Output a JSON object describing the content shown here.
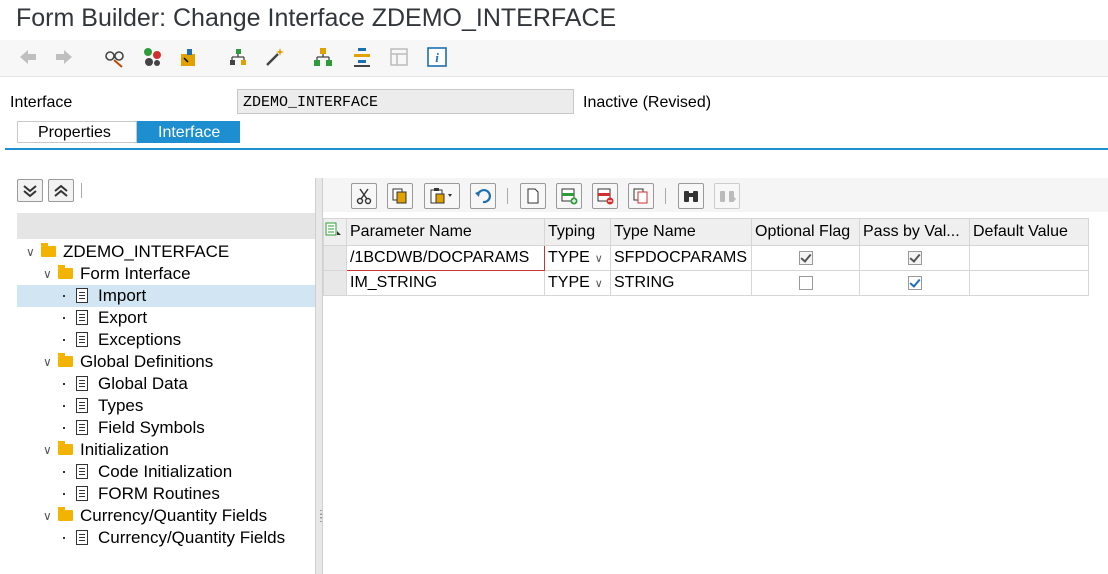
{
  "window": {
    "title": "Form Builder: Change Interface ZDEMO_INTERFACE"
  },
  "toolbar": {
    "icons": [
      "back-arrow-icon",
      "forward-arrow-icon",
      "glasses-display-change-icon",
      "activate-icon",
      "check-icon",
      "where-used-icon",
      "magic-wand-icon",
      "hierarchy-icon",
      "layout-icon",
      "layout-disabled-icon",
      "info-icon"
    ]
  },
  "header": {
    "interface_label": "Interface",
    "interface_value": "ZDEMO_INTERFACE",
    "status": "Inactive (Revised)"
  },
  "tabs": [
    {
      "label": "Properties",
      "active": false
    },
    {
      "label": "Interface",
      "active": true
    }
  ],
  "tree": {
    "nodes": [
      {
        "label": "ZDEMO_INTERFACE",
        "type": "folder",
        "level": 0,
        "expanded": true
      },
      {
        "label": "Form Interface",
        "type": "folder",
        "level": 1,
        "expanded": true
      },
      {
        "label": "Import",
        "type": "doc",
        "level": 2,
        "selected": true
      },
      {
        "label": "Export",
        "type": "doc",
        "level": 2
      },
      {
        "label": "Exceptions",
        "type": "doc",
        "level": 2
      },
      {
        "label": "Global Definitions",
        "type": "folder",
        "level": 1,
        "expanded": true
      },
      {
        "label": "Global Data",
        "type": "doc",
        "level": 2
      },
      {
        "label": "Types",
        "type": "doc",
        "level": 2
      },
      {
        "label": "Field Symbols",
        "type": "doc",
        "level": 2
      },
      {
        "label": "Initialization",
        "type": "folder",
        "level": 1,
        "expanded": true
      },
      {
        "label": "Code Initialization",
        "type": "doc",
        "level": 2
      },
      {
        "label": "FORM Routines",
        "type": "doc",
        "level": 2
      },
      {
        "label": "Currency/Quantity Fields",
        "type": "folder",
        "level": 1,
        "expanded": true
      },
      {
        "label": "Currency/Quantity Fields",
        "type": "doc",
        "level": 2
      }
    ]
  },
  "grid": {
    "columns": [
      "Parameter Name",
      "Typing",
      "Type Name",
      "Optional Flag",
      "Pass by Val...",
      "Default Value"
    ],
    "rows": [
      {
        "param": "/1BCDWB/DOCPARAMS",
        "typing": "TYPE",
        "type_name": "SFPDOCPARAMS",
        "optional": true,
        "optional_readonly": true,
        "pass_by_value": true,
        "pass_readonly": true,
        "default": ""
      },
      {
        "param": "IM_STRING",
        "typing": "TYPE",
        "type_name": "STRING",
        "optional": false,
        "optional_readonly": false,
        "pass_by_value": true,
        "pass_readonly": false,
        "default": ""
      }
    ]
  },
  "colors": {
    "accent": "#1d8ed0",
    "selection": "#d1e6f2",
    "folder": "#f2b400"
  }
}
